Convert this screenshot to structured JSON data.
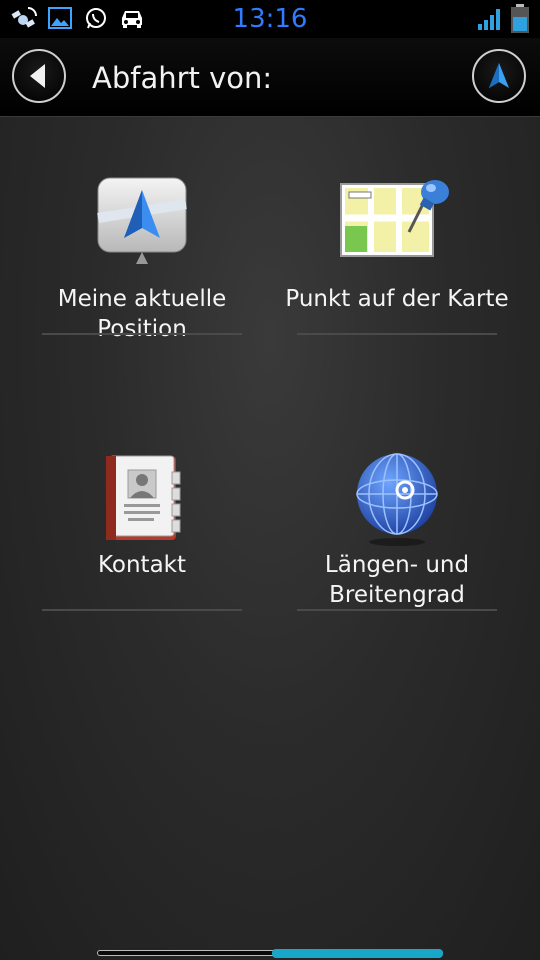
{
  "status_bar": {
    "time": "13:16",
    "icons": [
      "satellite-icon",
      "image-icon",
      "whatsapp-icon",
      "car-icon",
      "signal-icon",
      "battery-icon"
    ]
  },
  "header": {
    "title": "Abfahrt von:",
    "back_icon": "back-arrow-icon",
    "nav_icon": "navigation-arrow-icon"
  },
  "options": [
    {
      "label": "Meine aktuelle Position",
      "icon": "current-position-icon"
    },
    {
      "label": "Punkt auf der Karte",
      "icon": "map-point-icon"
    },
    {
      "label": "Kontakt",
      "icon": "contact-book-icon"
    },
    {
      "label": "Längen- und Breitengrad",
      "icon": "globe-coordinates-icon"
    }
  ],
  "scroll_indicator": {
    "position_fraction": 0.5
  },
  "colors": {
    "time": "#2f7cff",
    "accent": "#18a7c9",
    "background": "#2b2b2b"
  }
}
